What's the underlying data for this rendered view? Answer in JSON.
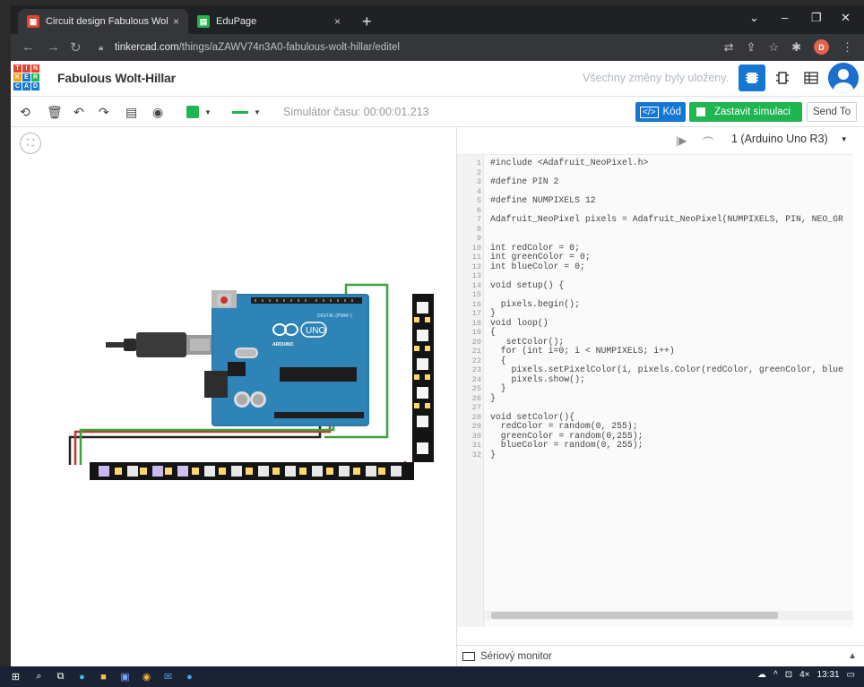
{
  "browser": {
    "tabs": [
      {
        "title": "Circuit design Fabulous Wolt-Hill",
        "active": true
      },
      {
        "title": "EduPage",
        "active": false
      }
    ],
    "url_host": "tinkercad.com",
    "url_path": "/things/aZAWV74n3A0-fabulous-wolt-hillar/editel",
    "profile_initial": "D",
    "new_tab": "+",
    "close_glyph": "×"
  },
  "app": {
    "logo_letters": [
      "T",
      "I",
      "N",
      "K",
      "E",
      "R",
      "C",
      "A",
      "D"
    ],
    "logo_colors": [
      "#e2452f",
      "#e2452f",
      "#e2452f",
      "#f2a007",
      "#1477d4",
      "#1fb551",
      "#1477d4",
      "#1477d4",
      "#1477d4"
    ],
    "project_title": "Fabulous Wolt-Hillar",
    "saved_status": "Všechny změny byly uloženy.",
    "sim_time_label": "Simulátor času: 00:00:01.213",
    "code_button": "Kód",
    "stop_button": "Zastavit simulaci",
    "send_button": "Send To",
    "board": "1 (Arduino Uno R3)",
    "serial_monitor": "Sériový monitor",
    "accent_blue": "#1477d4",
    "accent_green": "#1fb551"
  },
  "canvas": {
    "arduino_logo_text": "UNO",
    "arduino_brand": "ARDUINO",
    "digital_label": "DIGITAL (PWM~)"
  },
  "code": {
    "lines": [
      "#include <Adafruit_NeoPixel.h>",
      "",
      "#define PIN 2",
      "",
      "#define NUMPIXELS 12",
      "",
      "Adafruit_NeoPixel pixels = Adafruit_NeoPixel(NUMPIXELS, PIN, NEO_GR",
      "",
      "",
      "int redColor = 0;",
      "int greenColor = 0;",
      "int blueColor = 0;",
      "",
      "void setup() {",
      "",
      "  pixels.begin();",
      "}",
      "void loop()",
      "{",
      "   setColor();",
      "  for (int i=0; i < NUMPIXELS; i++)",
      "  {",
      "    pixels.setPixelColor(i, pixels.Color(redColor, greenColor, blue",
      "    pixels.show();",
      "  }",
      "}",
      "",
      "void setColor(){",
      "  redColor = random(0, 255);",
      "  greenColor = random(0,255);",
      "  blueColor = random(0, 255);",
      "}"
    ]
  },
  "taskbar": {
    "clock": "13:31",
    "volume": "4×"
  }
}
